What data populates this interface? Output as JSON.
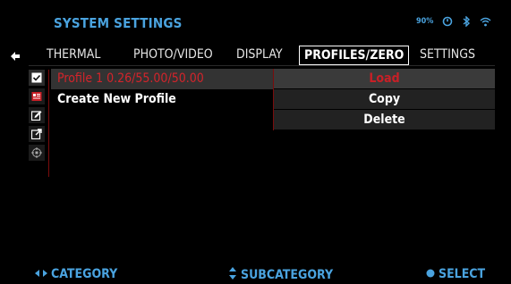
{
  "header": {
    "title": "SYSTEM SETTINGS",
    "battery": "90%"
  },
  "tabs": [
    {
      "label": "THERMAL"
    },
    {
      "label": "PHOTO/VIDEO"
    },
    {
      "label": "DISPLAY"
    },
    {
      "label": "PROFILES/ZERO",
      "active": true
    },
    {
      "label": "SETTINGS"
    }
  ],
  "side_icons": [
    "checkbox-icon",
    "profile-card-icon",
    "edit-icon",
    "export-icon",
    "zero-target-icon"
  ],
  "profiles": [
    {
      "label": "Profile 1 0.26/55.00/50.00",
      "selected": true
    },
    {
      "label": "Create New Profile"
    }
  ],
  "actions": [
    {
      "label": "Load",
      "selected": true
    },
    {
      "label": "Copy"
    },
    {
      "label": "Delete"
    }
  ],
  "footer": {
    "category": "CATEGORY",
    "subcategory": "SUBCATEGORY",
    "select": "SELECT"
  },
  "colors": {
    "accent": "#4aa3df",
    "selected_text": "#d4242b",
    "background": "#000000"
  }
}
